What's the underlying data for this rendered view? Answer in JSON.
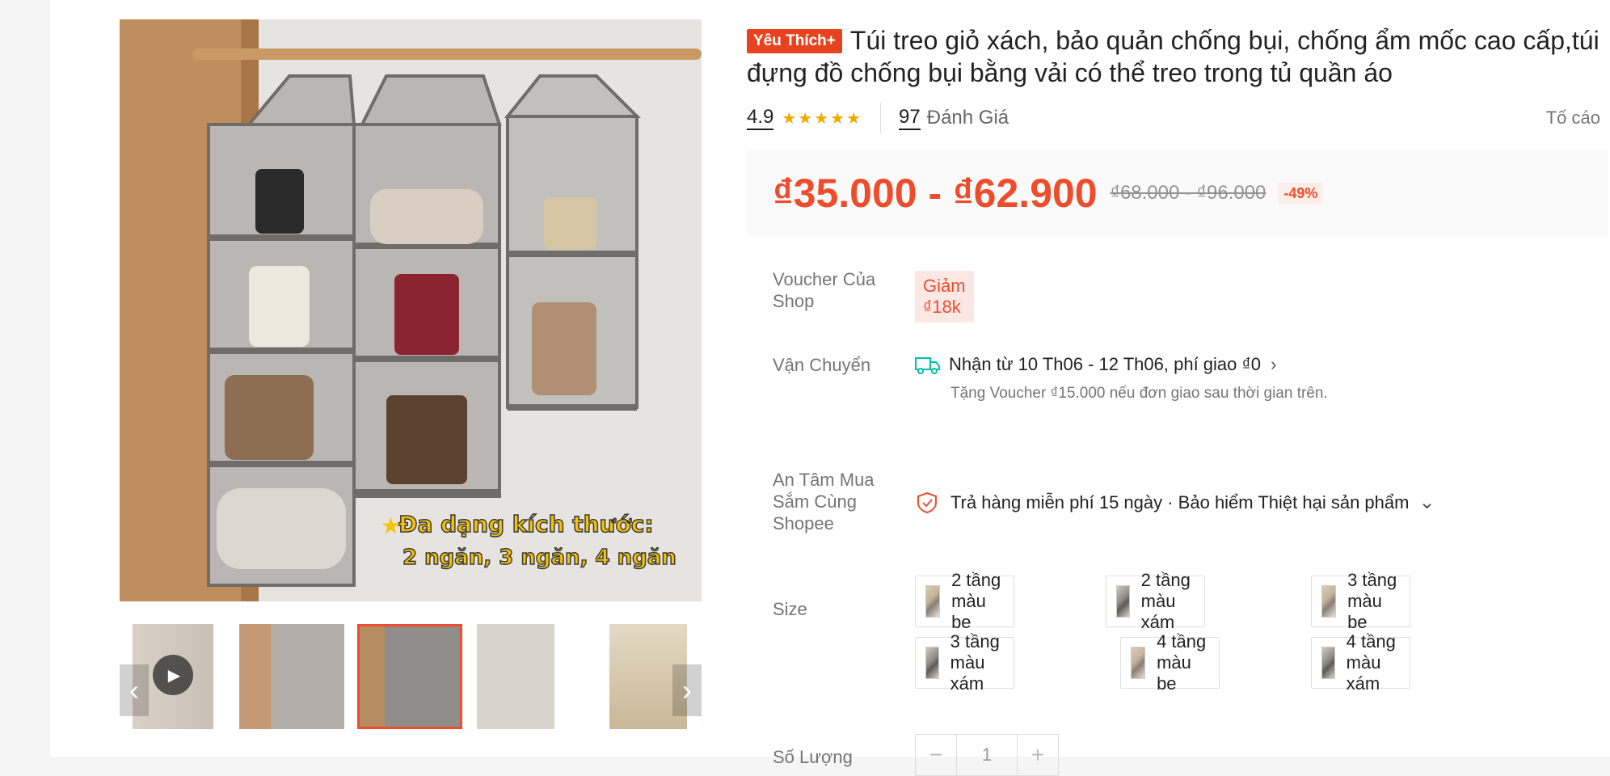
{
  "product": {
    "badge": "Yêu Thích+",
    "title": "Túi treo giỏ xách, bảo quản chống bụi, chống ẩm mốc cao cấp,túi đựng đồ chống bụi bằng vải có thể treo trong tủ quần áo",
    "rating": "4.9",
    "stars": "★★★★★",
    "review_count": "97",
    "review_label": "Đánh Giá",
    "report_label": "Tố cáo"
  },
  "price": {
    "current": "₫35.000 - ₫62.900",
    "original": "₫68.000 - ₫96.000",
    "discount": "-49%"
  },
  "voucher": {
    "label": "Voucher Của Shop",
    "chip": "Giảm ₫18k"
  },
  "shipping": {
    "label": "Vận Chuyển",
    "text": "Nhận từ 10 Th06 - 12 Th06, phí giao ₫0",
    "chevron": "›",
    "sub": "Tặng Voucher ₫15.000 nếu đơn giao sau thời gian trên."
  },
  "guarantee": {
    "label": "An Tâm Mua Sắm Cùng Shopee",
    "text": "Trả hàng miễn phí 15 ngày · Bảo hiểm Thiệt hại sản phẩm",
    "chevron": "⌄"
  },
  "size": {
    "label": "Size",
    "options": [
      {
        "label": "2 tầng màu be",
        "color": "beige"
      },
      {
        "label": "2 tầng màu xám",
        "color": "grey"
      },
      {
        "label": "3 tầng màu be",
        "color": "beige"
      },
      {
        "label": "3 tầng màu xám",
        "color": "grey"
      },
      {
        "label": "4 tầng màu be",
        "color": "beige"
      },
      {
        "label": "4 tầng màu xám",
        "color": "grey"
      }
    ]
  },
  "quantity": {
    "label": "Số Lượng",
    "minus": "−",
    "value": "1",
    "plus": "+"
  },
  "gallery": {
    "overlay_line1": "Đa dạng kích thước:",
    "overlay_line2": "2 ngăn, 3 ngăn, 4 ngăn",
    "prev_arrow": "‹",
    "next_arrow": "›",
    "play_icon": "▶"
  },
  "colors": {
    "accent": "#ee4d2d",
    "star": "#f6a700"
  }
}
